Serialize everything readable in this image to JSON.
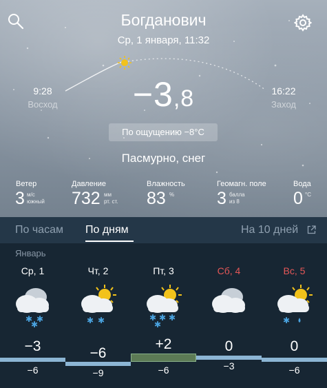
{
  "header": {
    "city": "Богданович",
    "date": "Ср, 1 января, 11:32"
  },
  "sun": {
    "sunrise_time": "9:28",
    "sunrise_label": "Восход",
    "sunset_time": "16:22",
    "sunset_label": "Заход"
  },
  "current": {
    "temp_main": "−3",
    "temp_fraction": ",8",
    "feels_like": "По ощущению −8°C",
    "condition": "Пасмурно, снег"
  },
  "stats": {
    "wind": {
      "label": "Ветер",
      "value": "3",
      "unit": "м/с",
      "sub": "южный"
    },
    "pressure": {
      "label": "Давление",
      "value": "732",
      "unit": "мм",
      "sub": "рт. ст."
    },
    "humidity": {
      "label": "Влажность",
      "value": "83",
      "unit": "%"
    },
    "geomag": {
      "label": "Геомагн. поле",
      "value": "3",
      "unit": "балла",
      "sub": "из 8"
    },
    "water": {
      "label": "Вода",
      "value": "0",
      "unit": "°C"
    }
  },
  "tabs": {
    "hours": "По часам",
    "days": "По дням",
    "ten_days": "На 10 дней"
  },
  "forecast": {
    "month": "Январь",
    "days": [
      {
        "name": "Ср, 1",
        "high": "−3",
        "low": "−6",
        "icon": "cloudy-snow-icon",
        "weekend": false
      },
      {
        "name": "Чт, 2",
        "high": "−6",
        "low": "−9",
        "icon": "partly-cloudy-snow-icon",
        "weekend": false
      },
      {
        "name": "Пт, 3",
        "high": "+2",
        "low": "−6",
        "icon": "partly-cloudy-snow-icon",
        "weekend": false
      },
      {
        "name": "Сб, 4",
        "high": "0",
        "low": "−3",
        "icon": "cloudy-icon",
        "weekend": true
      },
      {
        "name": "Вс, 5",
        "high": "0",
        "low": "−6",
        "icon": "partly-cloudy-sleet-icon",
        "weekend": true
      }
    ]
  },
  "colors": {
    "weekend": "#e45757",
    "bar_cold": "#8cb5d4",
    "bar_warm": "#5c7a55",
    "snowflake": "#4aa3e0",
    "sun": "#f2c21b"
  }
}
